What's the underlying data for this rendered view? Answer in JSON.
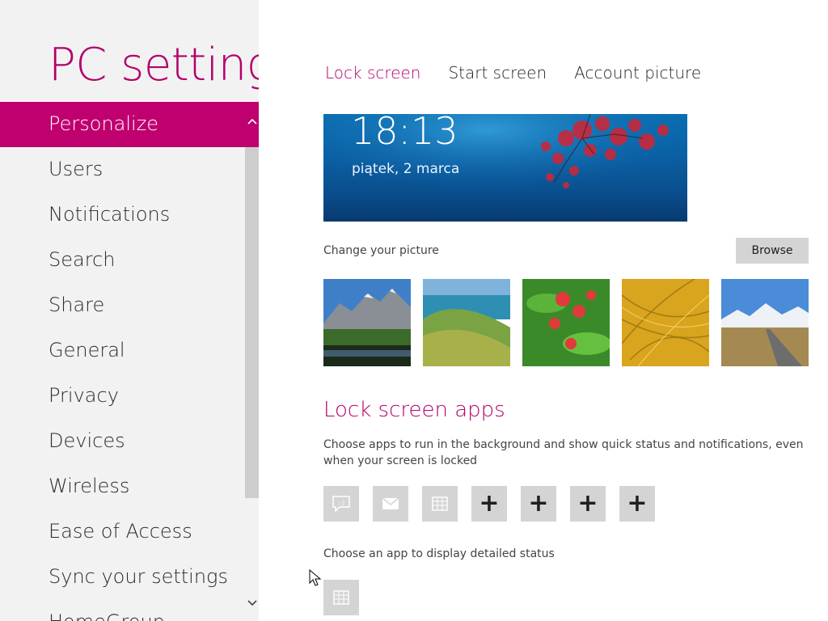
{
  "app": {
    "title": "PC settings"
  },
  "nav": {
    "items": [
      {
        "label": "Personalize",
        "selected": true
      },
      {
        "label": "Users"
      },
      {
        "label": "Notifications"
      },
      {
        "label": "Search"
      },
      {
        "label": "Share"
      },
      {
        "label": "General"
      },
      {
        "label": "Privacy"
      },
      {
        "label": "Devices"
      },
      {
        "label": "Wireless"
      },
      {
        "label": "Ease of Access"
      },
      {
        "label": "Sync your settings"
      },
      {
        "label": "HomeGroup"
      }
    ]
  },
  "tabs": [
    {
      "label": "Lock screen",
      "active": true
    },
    {
      "label": "Start screen"
    },
    {
      "label": "Account picture"
    }
  ],
  "lock_screen": {
    "preview": {
      "time": "18:13",
      "date": "piątek, 2 marca"
    },
    "change_picture_label": "Change your picture",
    "browse_label": "Browse",
    "thumbnails": [
      "mountain-lake",
      "coastal-hills",
      "red-flowers",
      "golden-grass",
      "mountain-road"
    ],
    "apps_heading": "Lock screen apps",
    "apps_description": "Choose apps to run in the background and show quick status and notifications, even when your screen is locked",
    "app_slots": [
      "messaging-icon",
      "mail-icon",
      "calendar-icon",
      "add",
      "add",
      "add",
      "add"
    ],
    "add_symbol": "+",
    "detailed_status_label": "Choose an app to display detailed status",
    "detailed_status_app": "calendar-icon"
  },
  "colors": {
    "accent": "#c0006f",
    "accent_text": "#b3006b",
    "nav_bg": "#f2f2f2",
    "slot_bg": "#d4d4d4"
  }
}
